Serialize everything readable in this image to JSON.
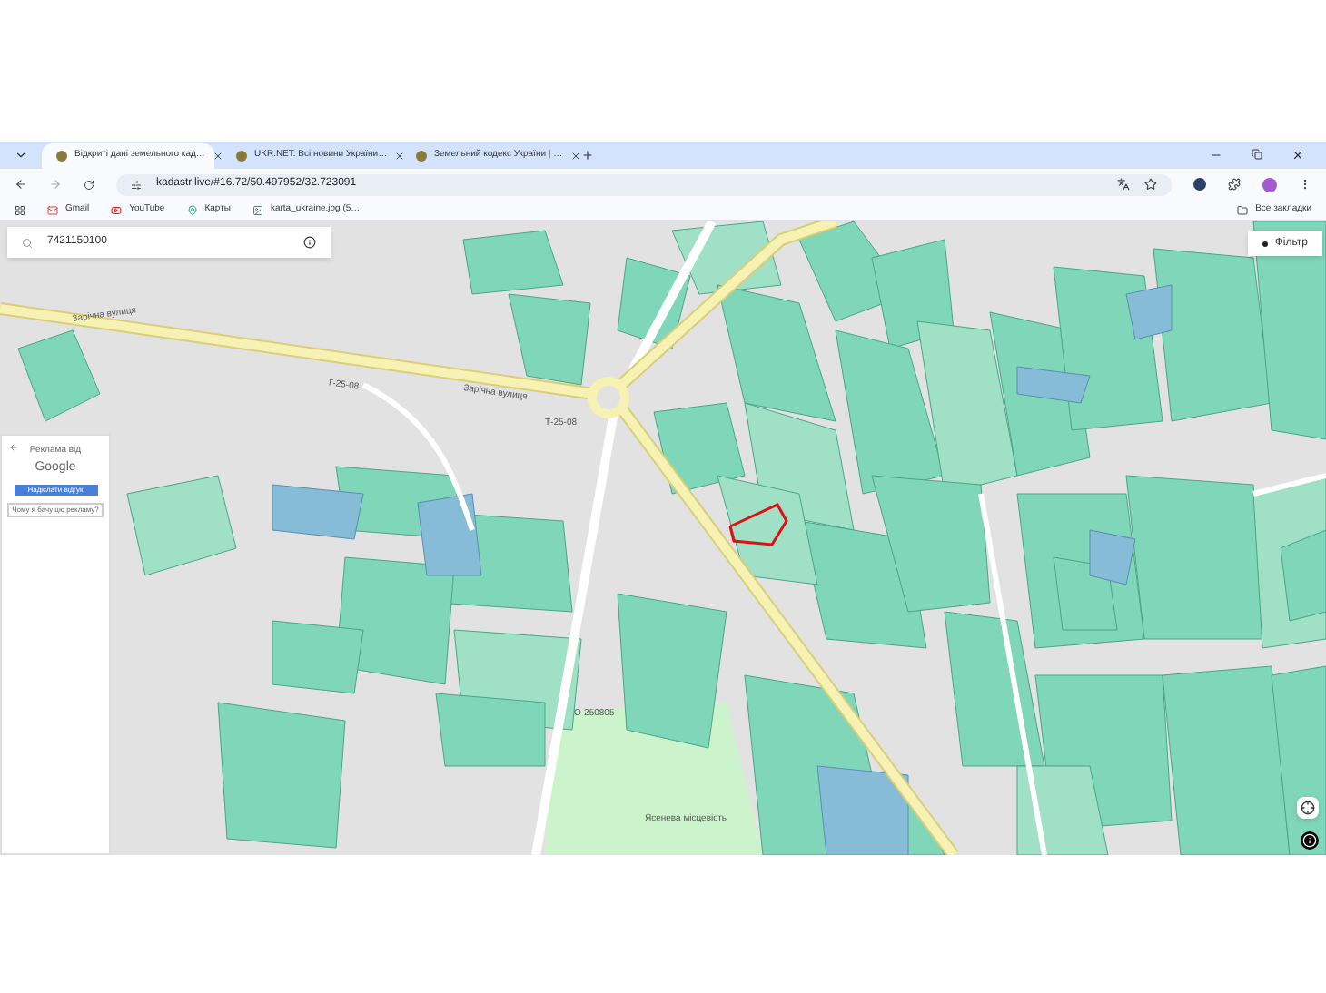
{
  "browser": {
    "tabs": [
      {
        "title": "Відкриті дані земельного кад…",
        "selected": true
      },
      {
        "title": "UKR.NET: Всі новини України…",
        "selected": false
      },
      {
        "title": "Земельний кодекс України | …",
        "selected": false
      }
    ],
    "url": "kadastr.live/#16.72/50.497952/32.723091",
    "bookmarks": [
      "Gmail",
      "YouTube",
      "Карты",
      "karta_ukraine.jpg (5…"
    ],
    "all_bookmarks": "Все закладки"
  },
  "map": {
    "search": {
      "value": "7421150100"
    },
    "filter_button": "Фільтр",
    "ad": {
      "title": "Реклама від",
      "brand": "Google",
      "feedback_button": "Надіслати відгук",
      "why_link": "Чому я бачу цю рекламу?"
    },
    "labels": [
      {
        "text": "Зарічна вулиця"
      },
      {
        "text": "Т-25-08"
      },
      {
        "text": "Зарічна вулиця"
      },
      {
        "text": "Т-25-08"
      },
      {
        "text": "О-250805"
      },
      {
        "text": "Ясенева місцевість"
      }
    ]
  }
}
